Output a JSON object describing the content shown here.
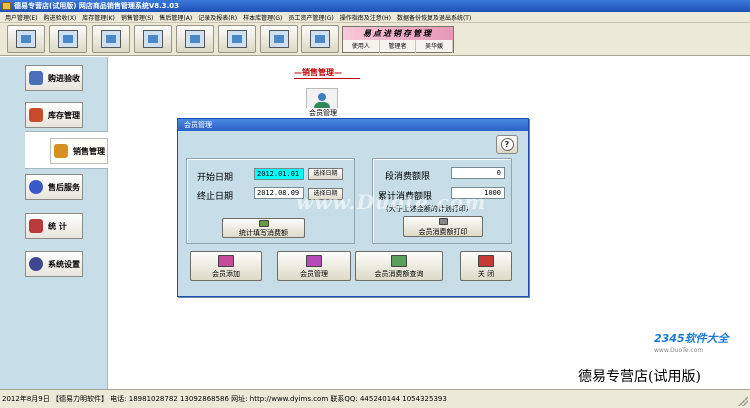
{
  "window": {
    "title": "德易专营店(试用版)  网店商品销售管理系统V8.3.03"
  },
  "menu": [
    "用户管理(E)",
    "购进验收(X)",
    "库存管理(K)",
    "销售管理(S)",
    "售后管理(A)",
    "记录及报表(R)",
    "样本库管理(G)",
    "员工资产管理(G)",
    "操作指南及注意(H)",
    "数据备份恢复及退出系统(T)"
  ],
  "toolbar": {
    "buttons": [
      "refresh-icon",
      "notebook-icon",
      "search-icon",
      "document-icon",
      "chart-icon",
      "calculator-icon",
      "ledger-icon",
      "exit-icon"
    ]
  },
  "userbox": {
    "banner": "易点进销存管理",
    "user_label": "使用人",
    "role": "管理者",
    "name": "吴华媛"
  },
  "nav": [
    {
      "label": "购进验收",
      "icon": "receiving-icon"
    },
    {
      "label": "库存管理",
      "icon": "inventory-icon"
    },
    {
      "label": "销售管理",
      "icon": "sales-icon"
    },
    {
      "label": "售后服务",
      "icon": "after-sales-icon"
    },
    {
      "label": "统  计",
      "icon": "statistics-icon"
    },
    {
      "label": "系统设置",
      "icon": "settings-icon"
    }
  ],
  "section": {
    "title": "—销售管理—",
    "member_icon_label": "会员管理"
  },
  "dialog": {
    "title": "会员管理",
    "help": "?",
    "start_label": "开始日期",
    "start_value": "2012.01.01",
    "end_label": "终止日期",
    "end_value": "2012.08.09",
    "select_date": "选择日期",
    "stat_button": "统计填写消费额",
    "segment_label": "段消费额限",
    "segment_value": "0",
    "cumulative_label": "累计消费额限",
    "cumulative_value": "1000",
    "note": "(大于上述金额的计划打印)",
    "print_button": "会员消费额打印",
    "buttons": {
      "add": "会员添加",
      "manage": "会员管理",
      "query": "会员消费额查询",
      "close": "关 闭"
    }
  },
  "watermark": "www.Duote.com",
  "logo": {
    "digits": "2345软件大全",
    "url": "www.DuoTe.com"
  },
  "brand": "德易专营店(试用版)",
  "status": "2012年8月9日  【德易力明软件】  电话: 18981028782  13092868586  网址: http://www.dyims.com  联系QQ: 445240144  1054325393"
}
